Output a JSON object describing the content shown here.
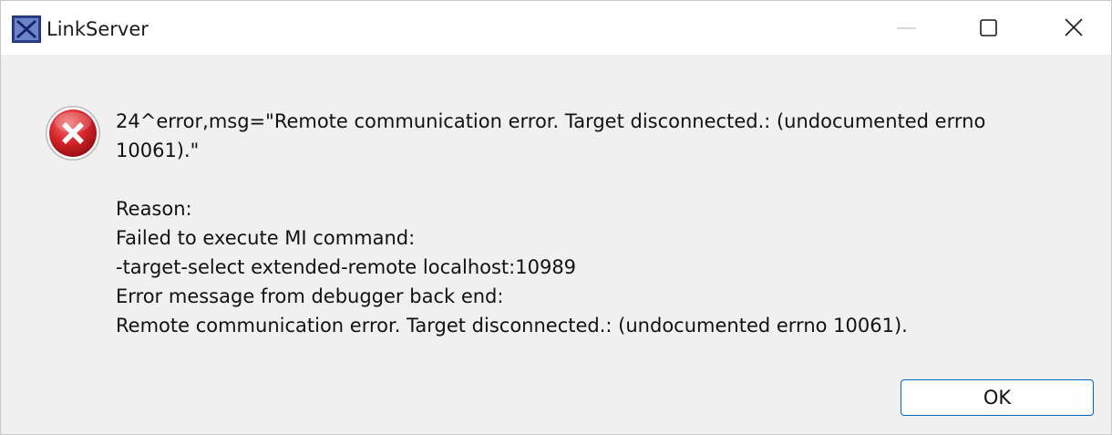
{
  "window": {
    "title": "LinkServer",
    "controls": {
      "minimize": "minimize-icon",
      "maximize": "maximize-icon",
      "close": "close-icon"
    }
  },
  "dialog": {
    "icon": "error-icon",
    "message": {
      "line1": "24^error,msg=\"Remote communication error.  Target disconnected.: (undocumented errno",
      "line2": "10061).\"",
      "line3": "Reason:",
      "line4": "Failed to execute MI command:",
      "line5": "-target-select extended-remote localhost:10989",
      "line6": "Error message from debugger back end:",
      "line7": "Remote communication error.  Target disconnected.: (undocumented errno 10061)."
    },
    "ok_label": "OK"
  },
  "colors": {
    "titlebar": "#ffffff",
    "body": "#f0f0f0",
    "error_red": "#d9262c",
    "button_border": "#0067c0"
  }
}
